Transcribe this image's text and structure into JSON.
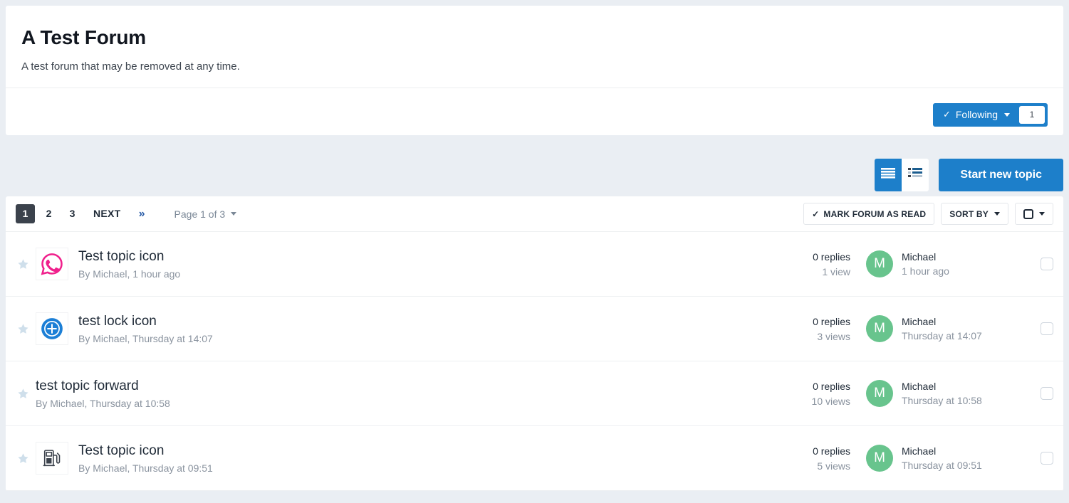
{
  "forum": {
    "title": "A Test Forum",
    "description": "A test forum that may be removed at any time.",
    "follow_label": "Following",
    "follow_count": "1"
  },
  "toolbar": {
    "view_list_icon": "list-view-icon",
    "view_grid_icon": "grid-view-icon",
    "start_topic_label": "Start new topic"
  },
  "list_header": {
    "pages": [
      "1",
      "2",
      "3"
    ],
    "next_label": "NEXT",
    "last_label": "»",
    "page_indicator": "Page 1 of 3",
    "mark_read_label": "MARK FORUM AS READ",
    "sort_by_label": "SORT BY"
  },
  "topics": [
    {
      "title": "Test topic icon",
      "meta": "By Michael, 1 hour ago",
      "icon": "whatsapp-icon",
      "replies": "0 replies",
      "views": "1 view",
      "author": "Michael",
      "date": "1 hour ago",
      "avatar_initial": "M"
    },
    {
      "title": "test lock icon",
      "meta": "By Michael, Thursday at 14:07",
      "icon": "plus-circle-icon",
      "replies": "0 replies",
      "views": "3 views",
      "author": "Michael",
      "date": "Thursday at 14:07",
      "avatar_initial": "M"
    },
    {
      "title": "test topic forward",
      "meta": "By Michael, Thursday at 10:58",
      "icon": "none",
      "replies": "0 replies",
      "views": "10 views",
      "author": "Michael",
      "date": "Thursday at 10:58",
      "avatar_initial": "M"
    },
    {
      "title": "Test topic icon",
      "meta": "By Michael, Thursday at 09:51",
      "icon": "fuel-pump-icon",
      "replies": "0 replies",
      "views": "5 views",
      "author": "Michael",
      "date": "Thursday at 09:51",
      "avatar_initial": "M"
    }
  ],
  "colors": {
    "accent_blue": "#1d7fca",
    "avatar_green": "#68c48d",
    "page_bg": "#eaeef3",
    "star_blue": "#cfdfeb",
    "whatsapp_pink": "#f0208c",
    "active_page_bg": "#3b424c"
  }
}
